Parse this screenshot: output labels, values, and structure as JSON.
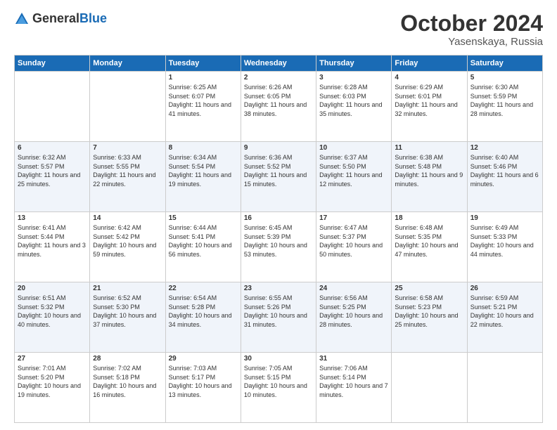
{
  "header": {
    "logo_general": "General",
    "logo_blue": "Blue",
    "month": "October 2024",
    "location": "Yasenskaya, Russia"
  },
  "weekdays": [
    "Sunday",
    "Monday",
    "Tuesday",
    "Wednesday",
    "Thursday",
    "Friday",
    "Saturday"
  ],
  "weeks": [
    [
      {
        "day": "",
        "sunrise": "",
        "sunset": "",
        "daylight": ""
      },
      {
        "day": "",
        "sunrise": "",
        "sunset": "",
        "daylight": ""
      },
      {
        "day": "1",
        "sunrise": "Sunrise: 6:25 AM",
        "sunset": "Sunset: 6:07 PM",
        "daylight": "Daylight: 11 hours and 41 minutes."
      },
      {
        "day": "2",
        "sunrise": "Sunrise: 6:26 AM",
        "sunset": "Sunset: 6:05 PM",
        "daylight": "Daylight: 11 hours and 38 minutes."
      },
      {
        "day": "3",
        "sunrise": "Sunrise: 6:28 AM",
        "sunset": "Sunset: 6:03 PM",
        "daylight": "Daylight: 11 hours and 35 minutes."
      },
      {
        "day": "4",
        "sunrise": "Sunrise: 6:29 AM",
        "sunset": "Sunset: 6:01 PM",
        "daylight": "Daylight: 11 hours and 32 minutes."
      },
      {
        "day": "5",
        "sunrise": "Sunrise: 6:30 AM",
        "sunset": "Sunset: 5:59 PM",
        "daylight": "Daylight: 11 hours and 28 minutes."
      }
    ],
    [
      {
        "day": "6",
        "sunrise": "Sunrise: 6:32 AM",
        "sunset": "Sunset: 5:57 PM",
        "daylight": "Daylight: 11 hours and 25 minutes."
      },
      {
        "day": "7",
        "sunrise": "Sunrise: 6:33 AM",
        "sunset": "Sunset: 5:55 PM",
        "daylight": "Daylight: 11 hours and 22 minutes."
      },
      {
        "day": "8",
        "sunrise": "Sunrise: 6:34 AM",
        "sunset": "Sunset: 5:54 PM",
        "daylight": "Daylight: 11 hours and 19 minutes."
      },
      {
        "day": "9",
        "sunrise": "Sunrise: 6:36 AM",
        "sunset": "Sunset: 5:52 PM",
        "daylight": "Daylight: 11 hours and 15 minutes."
      },
      {
        "day": "10",
        "sunrise": "Sunrise: 6:37 AM",
        "sunset": "Sunset: 5:50 PM",
        "daylight": "Daylight: 11 hours and 12 minutes."
      },
      {
        "day": "11",
        "sunrise": "Sunrise: 6:38 AM",
        "sunset": "Sunset: 5:48 PM",
        "daylight": "Daylight: 11 hours and 9 minutes."
      },
      {
        "day": "12",
        "sunrise": "Sunrise: 6:40 AM",
        "sunset": "Sunset: 5:46 PM",
        "daylight": "Daylight: 11 hours and 6 minutes."
      }
    ],
    [
      {
        "day": "13",
        "sunrise": "Sunrise: 6:41 AM",
        "sunset": "Sunset: 5:44 PM",
        "daylight": "Daylight: 11 hours and 3 minutes."
      },
      {
        "day": "14",
        "sunrise": "Sunrise: 6:42 AM",
        "sunset": "Sunset: 5:42 PM",
        "daylight": "Daylight: 10 hours and 59 minutes."
      },
      {
        "day": "15",
        "sunrise": "Sunrise: 6:44 AM",
        "sunset": "Sunset: 5:41 PM",
        "daylight": "Daylight: 10 hours and 56 minutes."
      },
      {
        "day": "16",
        "sunrise": "Sunrise: 6:45 AM",
        "sunset": "Sunset: 5:39 PM",
        "daylight": "Daylight: 10 hours and 53 minutes."
      },
      {
        "day": "17",
        "sunrise": "Sunrise: 6:47 AM",
        "sunset": "Sunset: 5:37 PM",
        "daylight": "Daylight: 10 hours and 50 minutes."
      },
      {
        "day": "18",
        "sunrise": "Sunrise: 6:48 AM",
        "sunset": "Sunset: 5:35 PM",
        "daylight": "Daylight: 10 hours and 47 minutes."
      },
      {
        "day": "19",
        "sunrise": "Sunrise: 6:49 AM",
        "sunset": "Sunset: 5:33 PM",
        "daylight": "Daylight: 10 hours and 44 minutes."
      }
    ],
    [
      {
        "day": "20",
        "sunrise": "Sunrise: 6:51 AM",
        "sunset": "Sunset: 5:32 PM",
        "daylight": "Daylight: 10 hours and 40 minutes."
      },
      {
        "day": "21",
        "sunrise": "Sunrise: 6:52 AM",
        "sunset": "Sunset: 5:30 PM",
        "daylight": "Daylight: 10 hours and 37 minutes."
      },
      {
        "day": "22",
        "sunrise": "Sunrise: 6:54 AM",
        "sunset": "Sunset: 5:28 PM",
        "daylight": "Daylight: 10 hours and 34 minutes."
      },
      {
        "day": "23",
        "sunrise": "Sunrise: 6:55 AM",
        "sunset": "Sunset: 5:26 PM",
        "daylight": "Daylight: 10 hours and 31 minutes."
      },
      {
        "day": "24",
        "sunrise": "Sunrise: 6:56 AM",
        "sunset": "Sunset: 5:25 PM",
        "daylight": "Daylight: 10 hours and 28 minutes."
      },
      {
        "day": "25",
        "sunrise": "Sunrise: 6:58 AM",
        "sunset": "Sunset: 5:23 PM",
        "daylight": "Daylight: 10 hours and 25 minutes."
      },
      {
        "day": "26",
        "sunrise": "Sunrise: 6:59 AM",
        "sunset": "Sunset: 5:21 PM",
        "daylight": "Daylight: 10 hours and 22 minutes."
      }
    ],
    [
      {
        "day": "27",
        "sunrise": "Sunrise: 7:01 AM",
        "sunset": "Sunset: 5:20 PM",
        "daylight": "Daylight: 10 hours and 19 minutes."
      },
      {
        "day": "28",
        "sunrise": "Sunrise: 7:02 AM",
        "sunset": "Sunset: 5:18 PM",
        "daylight": "Daylight: 10 hours and 16 minutes."
      },
      {
        "day": "29",
        "sunrise": "Sunrise: 7:03 AM",
        "sunset": "Sunset: 5:17 PM",
        "daylight": "Daylight: 10 hours and 13 minutes."
      },
      {
        "day": "30",
        "sunrise": "Sunrise: 7:05 AM",
        "sunset": "Sunset: 5:15 PM",
        "daylight": "Daylight: 10 hours and 10 minutes."
      },
      {
        "day": "31",
        "sunrise": "Sunrise: 7:06 AM",
        "sunset": "Sunset: 5:14 PM",
        "daylight": "Daylight: 10 hours and 7 minutes."
      },
      {
        "day": "",
        "sunrise": "",
        "sunset": "",
        "daylight": ""
      },
      {
        "day": "",
        "sunrise": "",
        "sunset": "",
        "daylight": ""
      }
    ]
  ]
}
